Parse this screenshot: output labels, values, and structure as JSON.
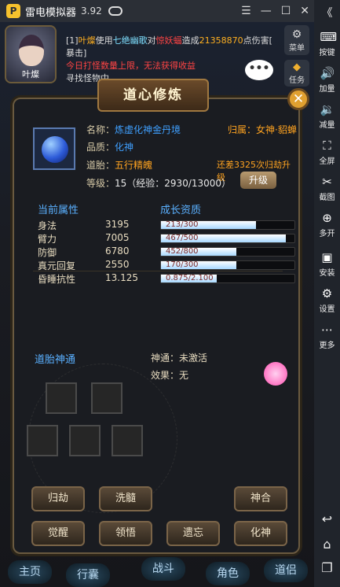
{
  "emulator": {
    "title": "雷电模拟器",
    "version": "3.92",
    "logo_glyph": "P",
    "controls": [
      "☰",
      "—",
      "☐",
      "✕",
      "《"
    ]
  },
  "sidebar": {
    "items": [
      {
        "label": "按键",
        "icon": "keyboard-icon",
        "glyph": "⌨"
      },
      {
        "label": "加量",
        "icon": "volume-up-icon",
        "glyph": "🔊"
      },
      {
        "label": "减量",
        "icon": "volume-down-icon",
        "glyph": "🔉"
      },
      {
        "label": "全屏",
        "icon": "fullscreen-icon",
        "glyph": "⛶"
      },
      {
        "label": "截图",
        "icon": "scissors-icon",
        "glyph": "✂"
      },
      {
        "label": "多开",
        "icon": "multi-open-icon",
        "glyph": "⊕"
      },
      {
        "label": "安装",
        "icon": "apk-install-icon",
        "glyph": "▣"
      },
      {
        "label": "设置",
        "icon": "gear-icon",
        "glyph": "⚙"
      },
      {
        "label": "更多",
        "icon": "more-icon",
        "glyph": "⋯"
      }
    ],
    "bottom": [
      {
        "icon": "back-icon",
        "glyph": "↩"
      },
      {
        "icon": "home-icon",
        "glyph": "⌂"
      },
      {
        "icon": "recent-apps-icon",
        "glyph": "❐"
      }
    ]
  },
  "hud": {
    "player_name": "叶燦",
    "menu_label": "菜单",
    "task_label": "任务",
    "bubble": "•••",
    "chat": {
      "line1_prefix": "[1]",
      "line1_name": "叶燦",
      "line1_used": "使用",
      "line1_skill": "七绝幽歌",
      "line1_to": "对",
      "line1_target": "惊妖蝠",
      "line1_dealt": "造成",
      "line1_damage": "21358870",
      "line1_suffix": "点伤害[",
      "line2": "暴击]",
      "line3": "今日打怪数量上限，无法获得收益",
      "line4": "寻找怪物中..."
    }
  },
  "panel": {
    "title": "道心修炼",
    "close_glyph": "✕",
    "name_label": "名称：",
    "name_value": "炼虚化神金丹境",
    "belong": "归属：女神·貂蝉",
    "quality_label": "品质：",
    "quality_value": "化神",
    "embryo_label": "道胎：",
    "embryo_value": "五行精魄",
    "upgrade_hint": "还差3325次归劫升级",
    "level_label": "等级：",
    "level_value": "15（经验：2930/13000）",
    "upgrade_button": "升级",
    "attr_header": "当前属性",
    "growth_header": "成长资质",
    "attributes": [
      {
        "name": "身法",
        "value": "3195",
        "growth": "213/300",
        "ratio": 0.71
      },
      {
        "name": "臂力",
        "value": "7005",
        "growth": "467/500",
        "ratio": 0.934
      },
      {
        "name": "防御",
        "value": "6780",
        "growth": "452/800",
        "ratio": 0.565
      },
      {
        "name": "真元回复",
        "value": "2550",
        "growth": "170/300",
        "ratio": 0.567
      },
      {
        "name": "昏睡抗性",
        "value": "13.125",
        "growth": "0.875/2.100",
        "ratio": 0.417
      }
    ],
    "skill_header": "道胎神通",
    "skill_label": "神通：",
    "skill_value": "未激活",
    "effect_label": "效果：",
    "effect_value": "无",
    "actions": [
      "归劫",
      "洗髓",
      "神合",
      "觉醒",
      "领悟",
      "遗忘",
      "化神"
    ]
  },
  "bottom_nav": [
    "主页",
    "行囊",
    "战斗",
    "角色",
    "道侣"
  ]
}
